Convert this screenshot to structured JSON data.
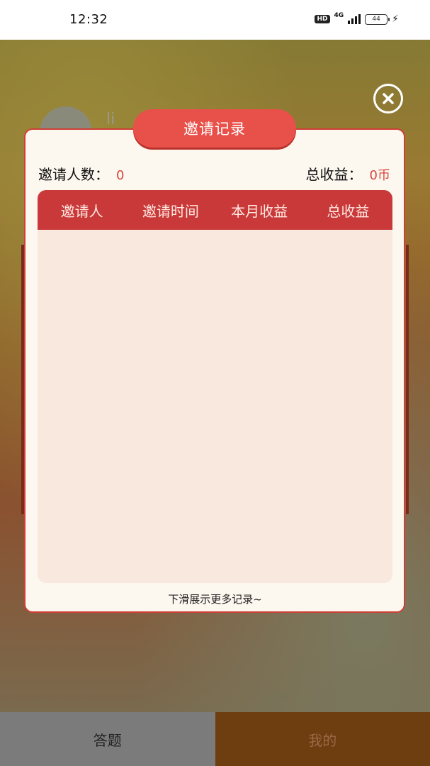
{
  "status_bar": {
    "time": "12:32",
    "hd": "HD",
    "network": "4G",
    "battery": "44"
  },
  "background": {
    "name_fragment": "li"
  },
  "modal": {
    "title": "邀请记录",
    "invite_count_label": "邀请人数：",
    "invite_count_value": "0",
    "total_earnings_label": "总收益：",
    "total_earnings_value": "0币",
    "table": {
      "columns": [
        "邀请人",
        "邀请时间",
        "本月收益",
        "总收益"
      ],
      "rows": []
    },
    "more_hint": "下滑展示更多记录~"
  },
  "tabs": [
    {
      "label": "答题"
    },
    {
      "label": "我的"
    }
  ],
  "colors": {
    "accent": "#e8504a",
    "table_header": "#c9393a",
    "value_red": "#d6453d"
  }
}
